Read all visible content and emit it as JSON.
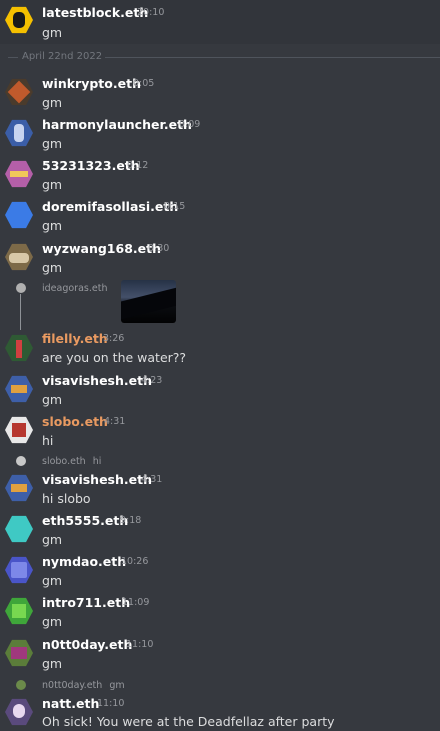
{
  "channel": {
    "date_divider": "April 22nd 2022"
  },
  "messages": [
    {
      "user": "latestblock.eth",
      "time": "20:10",
      "text": "gm",
      "avatar_color": "#f5c000"
    },
    {
      "user": "winkrypto.eth",
      "time": "0:05",
      "text": "gm",
      "avatar_color": "#4a3b2c"
    },
    {
      "user": "harmonylauncher.eth",
      "time": "0:09",
      "text": "gm",
      "avatar_color": "#3b5ea8"
    },
    {
      "user": "53231323.eth",
      "time": "0:12",
      "text": "gm",
      "avatar_color": "#b45fa8"
    },
    {
      "user": "doremifasollasi.eth",
      "time": "0:15",
      "text": "gm",
      "avatar_color": "#3b7be6"
    },
    {
      "user": "wyzwang168.eth",
      "time": "0:30",
      "text": "gm",
      "avatar_color": "#7d6a48"
    },
    {
      "user": "ideagoras.eth",
      "time": "",
      "text": "",
      "avatar_color": "#888888",
      "has_image": true
    },
    {
      "user": "filelly.eth",
      "time": "3:26",
      "text": "are you on the water??",
      "avatar_color": "#2f5a34",
      "orange": true
    },
    {
      "user": "visavishesh.eth",
      "time": "4:23",
      "text": "gm",
      "avatar_color": "#3e5fa8"
    },
    {
      "user": "slobo.eth",
      "time": "4:31",
      "text": "hi",
      "avatar_color": "#b6372f",
      "orange": true
    },
    {
      "user": "visavishesh.eth",
      "time": "4:31",
      "text": "hi slobo",
      "avatar_color": "#3e5fa8",
      "reply_to": "slobo.eth",
      "reply_text": "hi"
    },
    {
      "user": "eth5555.eth",
      "time": "9:18",
      "text": "gm",
      "avatar_color": "#3fc9c4"
    },
    {
      "user": "nymdao.eth",
      "time": "10:26",
      "text": "gm",
      "avatar_color": "#4a55c8"
    },
    {
      "user": "intro711.eth",
      "time": "11:09",
      "text": "gm",
      "avatar_color": "#3fa63a"
    },
    {
      "user": "n0tt0day.eth",
      "time": "11:10",
      "text": "gm",
      "avatar_color": "#5b7d3a"
    },
    {
      "user": "natt.eth",
      "time": "11:10",
      "text": "Oh sick! You were at the Deadfellaz after party",
      "avatar_color": "#5a4a7d",
      "reply_to": "n0tt0day.eth",
      "reply_text": "gm"
    }
  ]
}
